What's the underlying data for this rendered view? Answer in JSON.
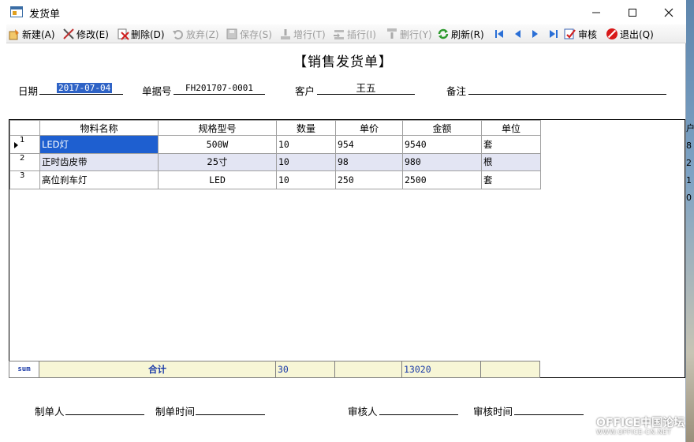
{
  "window": {
    "title": "发货单"
  },
  "toolbar": [
    {
      "label": "新建(A)",
      "icon": "new-icon",
      "enabled": true
    },
    {
      "label": "修改(E)",
      "icon": "edit-icon",
      "enabled": true
    },
    {
      "label": "删除(D)",
      "icon": "delete-icon",
      "enabled": true
    },
    {
      "label": "放弃(Z)",
      "icon": "undo-icon",
      "enabled": false
    },
    {
      "label": "保存(S)",
      "icon": "save-icon",
      "enabled": false
    },
    {
      "label": "增行(T)",
      "icon": "add-row-icon",
      "enabled": false
    },
    {
      "label": "插行(I)",
      "icon": "insert-row-icon",
      "enabled": false
    },
    {
      "label": "删行(Y)",
      "icon": "delete-row-icon",
      "enabled": false
    },
    {
      "label": "刷新(R)",
      "icon": "refresh-icon",
      "enabled": true
    },
    {
      "label": "审核",
      "icon": "approve-icon",
      "enabled": true
    },
    {
      "label": "退出(Q)",
      "icon": "exit-icon",
      "enabled": true
    }
  ],
  "form": {
    "title": "【销售发货单】",
    "date_label": "日期",
    "date_value": "2017-07-04",
    "doc_no_label": "单据号",
    "doc_no_value": "FH201707-0001",
    "customer_label": "客户",
    "customer_value": "王五",
    "remark_label": "备注",
    "remark_value": ""
  },
  "grid": {
    "columns": [
      "物料名称",
      "规格型号",
      "数量",
      "单价",
      "金额",
      "单位"
    ],
    "rows": [
      {
        "no": "1",
        "name": "LED灯",
        "spec": "500W",
        "qty": "10",
        "price": "954",
        "amount": "9540",
        "unit": "套"
      },
      {
        "no": "2",
        "name": "正时齿皮带",
        "spec": "25寸",
        "qty": "10",
        "price": "98",
        "amount": "980",
        "unit": "根"
      },
      {
        "no": "3",
        "name": "高位刹车灯",
        "spec": "LED",
        "qty": "10",
        "price": "250",
        "amount": "2500",
        "unit": "套"
      }
    ],
    "clipped_column": [
      "户",
      "8",
      "2",
      "1",
      "0"
    ]
  },
  "summary": {
    "label": "sum",
    "total_label": "合计",
    "qty_total": "30",
    "amount_total": "13020"
  },
  "footer": {
    "maker_label": "制单人",
    "make_time_label": "制单时间",
    "auditor_label": "审核人",
    "audit_time_label": "审核时间"
  },
  "watermark": {
    "main": "OFFICE中国论坛",
    "sub": "WWW.OFFICE-CN.NET"
  },
  "colors": {
    "selection": "#1e5fd0",
    "alt_row": "#e3e5f3",
    "sum_row": "#f7f6d6"
  }
}
